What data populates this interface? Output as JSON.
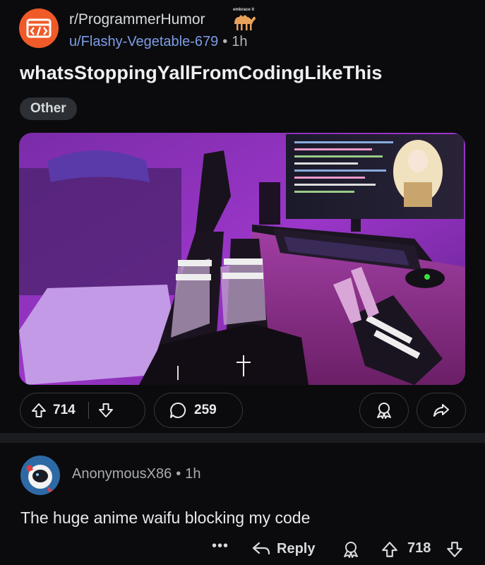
{
  "post": {
    "subreddit": "r/ProgrammerHumor",
    "flair_icon_text": "embrace it",
    "author": "u/Flashy-Vegetable-679",
    "separator": "•",
    "time": "1h",
    "title": "whatsStoppingYallFromCodingLikeThis",
    "flair": "Other",
    "upvotes": "714",
    "comments": "259"
  },
  "comment": {
    "author": "AnonymousX86",
    "separator": "•",
    "time": "1h",
    "body": "The huge anime waifu blocking my code",
    "more": "•••",
    "reply_label": "Reply",
    "score": "718"
  },
  "icons": {
    "subreddit_avatar": "code-window-icon",
    "flair": "camel-icon",
    "upvote": "arrow-up-icon",
    "downvote": "arrow-down-icon",
    "comments": "speech-bubble-icon",
    "award": "award-icon",
    "share": "share-arrow-icon",
    "reply": "reply-arrow-icon",
    "more": "more-dots-icon"
  },
  "colors": {
    "background": "#0b0b0d",
    "subreddit_accent": "#ef5a28",
    "username_link": "#7d9de6",
    "flair_bg": "#2c2f33",
    "pill_border": "#34373b"
  }
}
